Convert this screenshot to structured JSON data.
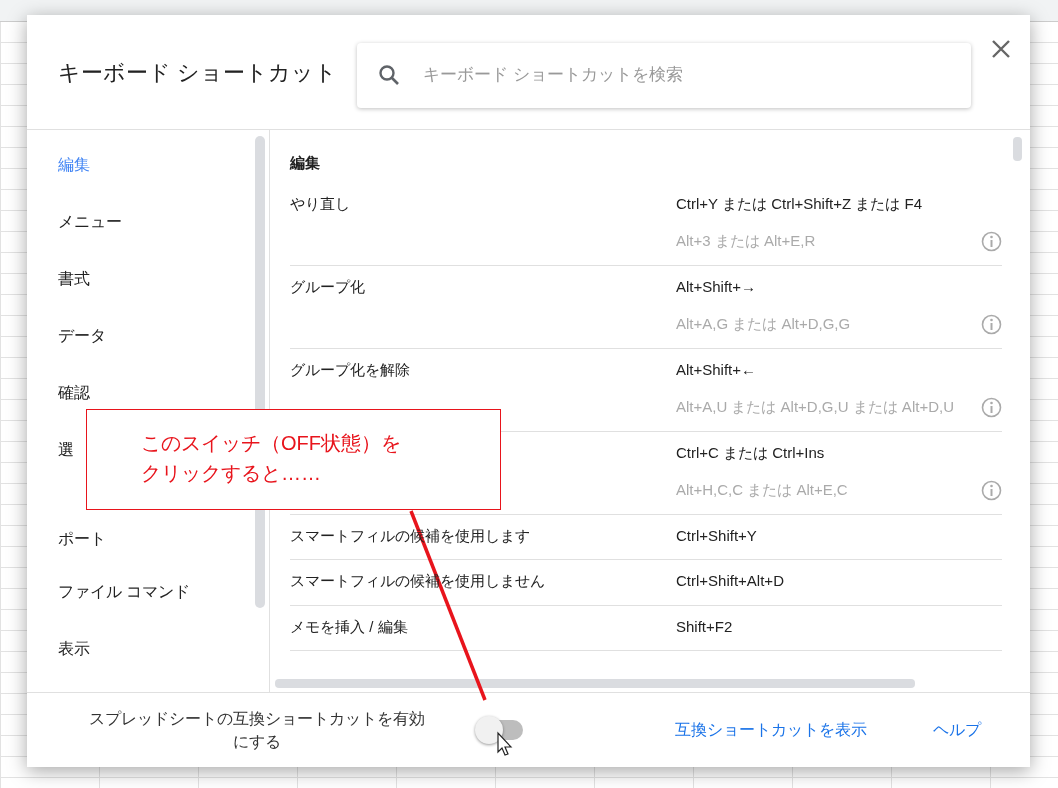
{
  "dialog": {
    "title": "キーボード ショートカット",
    "search": {
      "placeholder": "キーボード ショートカットを検索"
    },
    "sidebar": {
      "items": [
        {
          "label": "編集",
          "selected": true
        },
        {
          "label": "メニュー",
          "selected": false
        },
        {
          "label": "書式",
          "selected": false
        },
        {
          "label": "データ",
          "selected": false
        },
        {
          "label": "確認",
          "selected": false
        },
        {
          "label": "選",
          "selected": false
        },
        {
          "label": "ポート",
          "selected": false,
          "kind": "wrapped"
        },
        {
          "label": "ファイル コマンド",
          "selected": false
        },
        {
          "label": "表示",
          "selected": false
        }
      ]
    },
    "section": {
      "heading": "編集",
      "rows": [
        {
          "action": "やり直し",
          "shortcut": "Ctrl+Y または Ctrl+Shift+Z または F4",
          "alternate": "Alt+3 または Alt+E,R"
        },
        {
          "action": "グループ化",
          "shortcut": "Alt+Shift+→",
          "alternate": "Alt+A,G または Alt+D,G,G"
        },
        {
          "action": "グループ化を解除",
          "shortcut": "Alt+Shift+←",
          "alternate": "Alt+A,U または Alt+D,G,U または Alt+D,U"
        },
        {
          "shortcut": "Ctrl+C または Ctrl+Ins",
          "alternate": "Alt+H,C,C または Alt+E,C"
        },
        {
          "action": "スマートフィルの候補を使用します",
          "shortcut": "Ctrl+Shift+Y"
        },
        {
          "action": "スマートフィルの候補を使用しません",
          "shortcut": "Ctrl+Shift+Alt+D"
        },
        {
          "action": "メモを挿入 / 編集",
          "shortcut": "Shift+F2"
        }
      ]
    },
    "footer": {
      "toggle": {
        "label": "スプレッドシートの互換ショートカットを有効にする",
        "on": false
      },
      "links": [
        "互換ショートカットを表示",
        "ヘルプ"
      ]
    }
  },
  "annotation": {
    "lines": [
      "このスイッチ（OFF状態）を",
      "クリックすると……"
    ]
  }
}
